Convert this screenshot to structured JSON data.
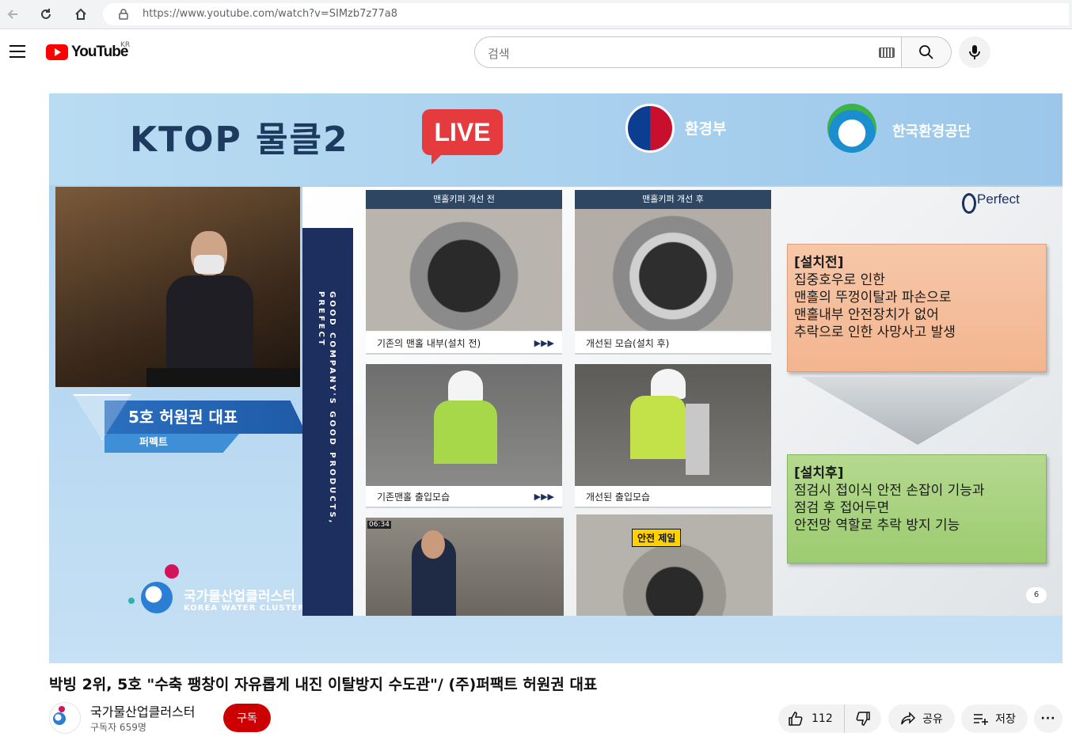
{
  "browser": {
    "url": "https://www.youtube.com/watch?v=SIMzb7z77a8"
  },
  "header": {
    "logo_text": "YouTube",
    "region": "KR",
    "search_placeholder": "검색"
  },
  "video_frame": {
    "program_title": "KTOP 물클2",
    "live_badge": "LIVE",
    "ministry": "환경부",
    "corporation": "한국환경공단",
    "speaker_title": "5호 허원권 대표",
    "speaker_company": "퍼펙트",
    "cluster_name": "국가물산업클러스터",
    "cluster_english": "KOREA WATER CLUSTER",
    "slide": {
      "sidebar_line1": "GOOD COMPANY'S GOOD PRODUCTS,",
      "sidebar_line2": "PREFECT",
      "header_before": "맨홀키퍼 개선 전",
      "header_after": "맨홀키퍼 개선 후",
      "caption_1": "기존의 맨홀 내부(설치 전)",
      "caption_2": "개선된 모습(설치 후)",
      "caption_3": "기존맨홀 출입모습",
      "caption_4": "개선된 출입모습",
      "arrows": "▶▶▶",
      "brand": "Perfect",
      "before_title": "[설치전]",
      "before_lines": [
        "집중호우로 인한",
        "맨홀의 뚜껑이탈과 파손으로",
        "맨홀내부 안전장치가 없어",
        "추락으로 인한 사망사고 발생"
      ],
      "after_title": "[설치후]",
      "after_lines": [
        "점검시 접이식 안전 손잡이 기능과",
        "점검 후 접어두면",
        "안전망 역할로 추락 방지 기능"
      ],
      "page_number": "6",
      "news_time": "06:34",
      "sign_text": "안전 제일"
    }
  },
  "video_info": {
    "title": "박빙 2위, 5호 \"수축 팽창이 자유롭게 내진 이탈방지 수도관\"/ (주)퍼팩트 허원권 대표",
    "channel_name": "국가물산업클러스터",
    "subscribers": "구독자 659명",
    "subscribe_label": "구독",
    "like_count": "112",
    "share_label": "공유",
    "save_label": "저장",
    "more_label": "···"
  },
  "colors": {
    "youtube_red": "#ff0000",
    "subscribe_red": "#cc0000",
    "slide_navy": "#1c2f5e"
  }
}
